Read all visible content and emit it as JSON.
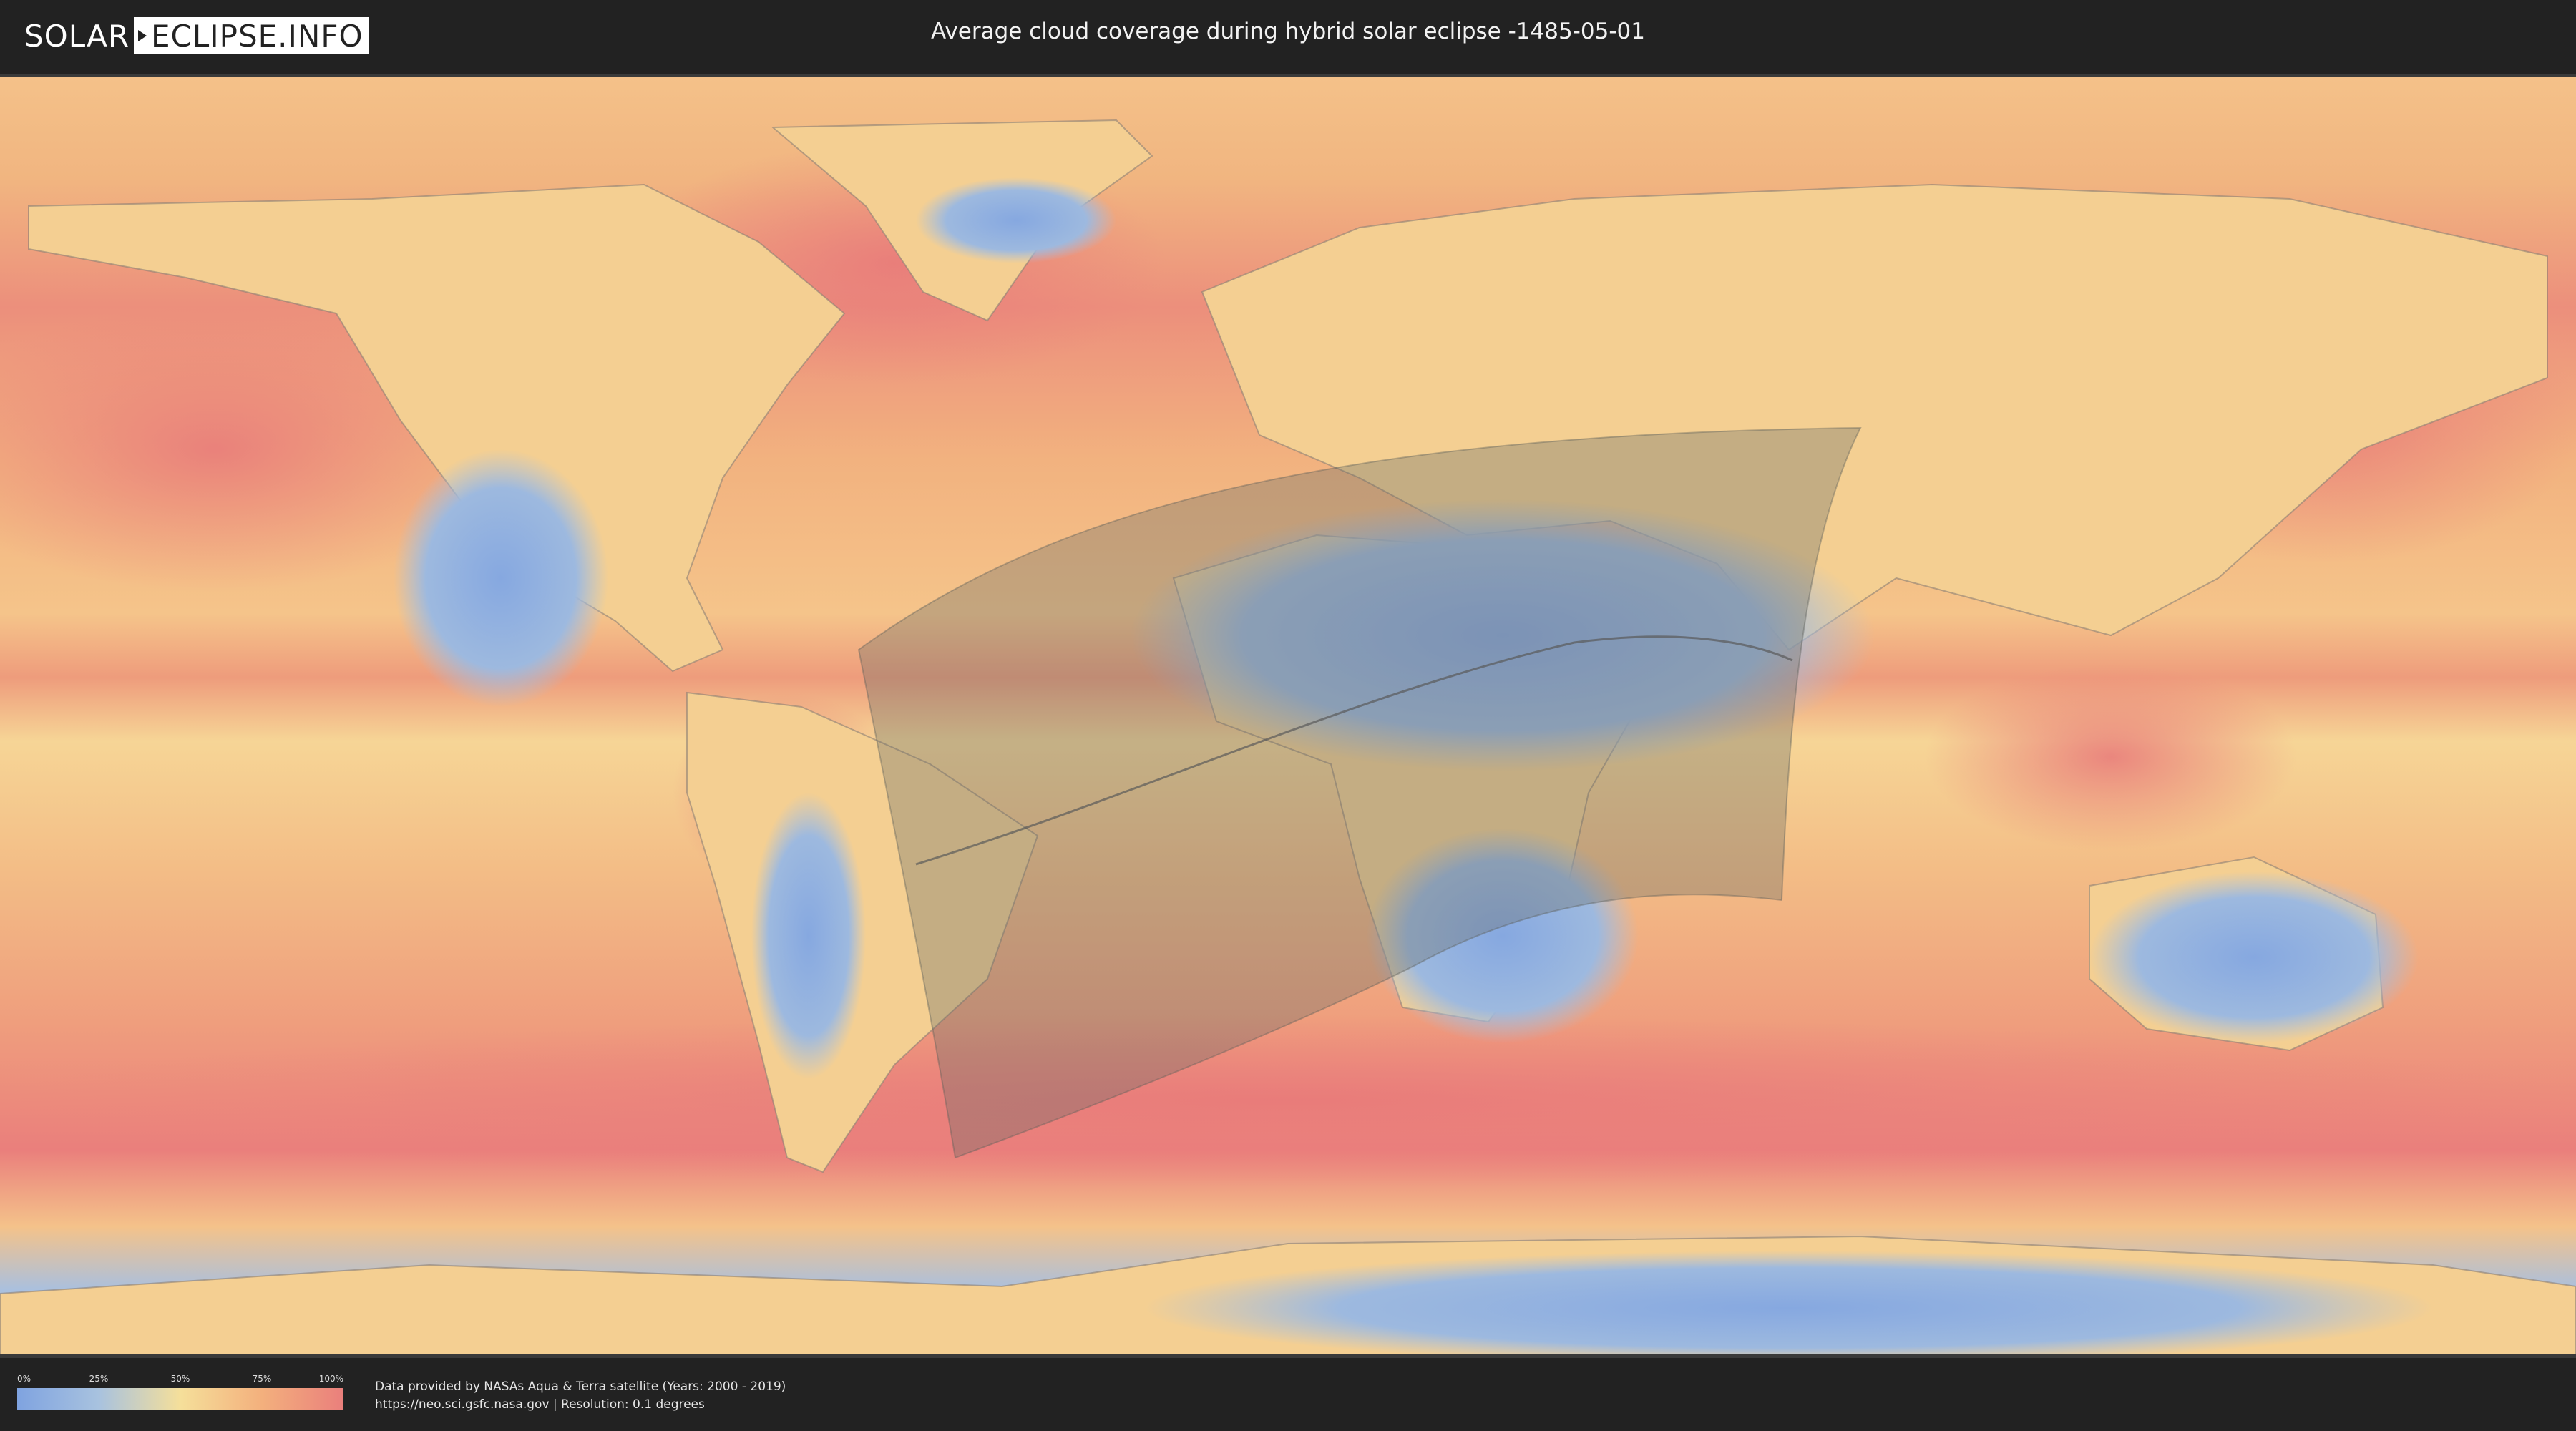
{
  "header": {
    "logo_left": "SOLAR",
    "logo_right": "ECLIPSE.INFO",
    "title": "Average cloud coverage during hybrid solar eclipse -1485-05-01"
  },
  "legend": {
    "ticks": [
      "0%",
      "25%",
      "50%",
      "75%",
      "100%"
    ],
    "colors": [
      "#7fa3e0",
      "#a8c2df",
      "#f5df9a",
      "#f3b07d",
      "#ea7f7c"
    ]
  },
  "credits": {
    "line1": "Data provided by NASAs Aqua & Terra satellite (Years: 2000 - 2019)",
    "line2": "https://neo.sci.gsfc.nasa.gov | Resolution: 0.1 degrees"
  },
  "map": {
    "ocean_color": "#f2b07e",
    "cloud_heavy_color": "#ea7f7c",
    "clear_sky_color": "#8fb0df",
    "shadow_color": "#6b6e66"
  }
}
